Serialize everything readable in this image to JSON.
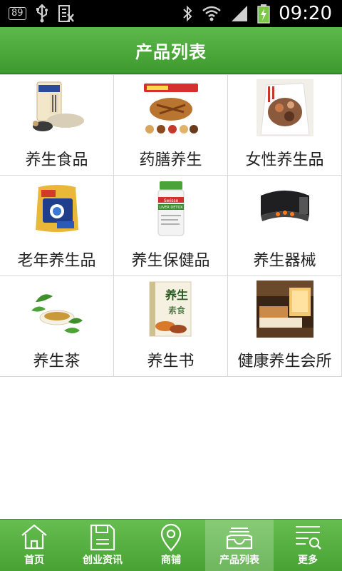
{
  "status_bar": {
    "battery_badge": "89",
    "time": "09:20",
    "icons": [
      "usb-icon",
      "screenshot-icon",
      "bluetooth-icon",
      "wifi-icon",
      "signal-icon",
      "battery-icon"
    ]
  },
  "header": {
    "title": "产品列表"
  },
  "products": [
    {
      "label": "养生食品",
      "icon": "health-food-image"
    },
    {
      "label": "药膳养生",
      "icon": "medicinal-diet-image"
    },
    {
      "label": "女性养生品",
      "icon": "women-health-image"
    },
    {
      "label": "老年养生品",
      "icon": "elderly-health-image"
    },
    {
      "label": "养生保健品",
      "icon": "supplement-bottle-image"
    },
    {
      "label": "养生器械",
      "icon": "health-device-image"
    },
    {
      "label": "养生茶",
      "icon": "tea-image"
    },
    {
      "label": "养生书",
      "icon": "book-image"
    },
    {
      "label": "健康养生会所",
      "icon": "spa-room-image"
    }
  ],
  "product_texts": {
    "bottle_label": "Swisse",
    "bottle_sub": "LIVER DETOX",
    "book_title": "养生",
    "book_sub": "素食"
  },
  "nav": [
    {
      "label": "首页",
      "icon": "home-icon",
      "active": false
    },
    {
      "label": "创业资讯",
      "icon": "save-icon",
      "active": false
    },
    {
      "label": "商铺",
      "icon": "location-pin-icon",
      "active": false
    },
    {
      "label": "产品列表",
      "icon": "inbox-tray-icon",
      "active": true
    },
    {
      "label": "更多",
      "icon": "list-search-icon",
      "active": false
    }
  ],
  "colors": {
    "accent": "#4caf3a",
    "nav_bg": "#58b043",
    "status_bg": "#000000"
  }
}
